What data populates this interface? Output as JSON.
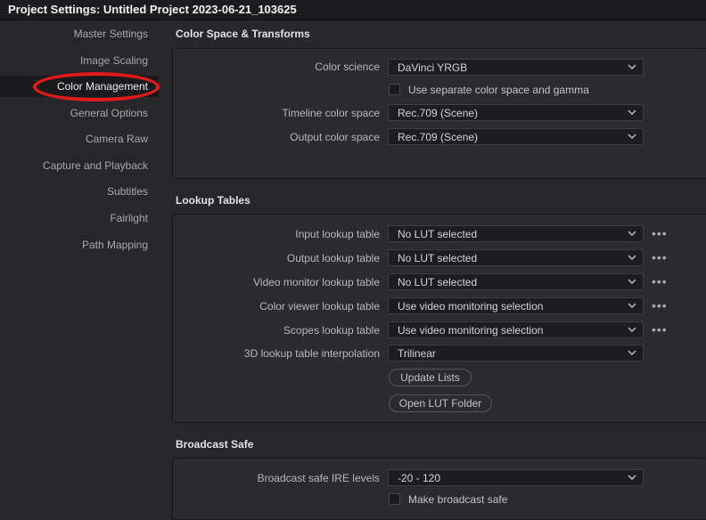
{
  "window": {
    "title": "Project Settings:  Untitled Project 2023-06-21_103625"
  },
  "sidebar": {
    "items": [
      {
        "label": "Master Settings"
      },
      {
        "label": "Image Scaling"
      },
      {
        "label": "Color Management",
        "active": true
      },
      {
        "label": "General Options"
      },
      {
        "label": "Camera Raw"
      },
      {
        "label": "Capture and Playback"
      },
      {
        "label": "Subtitles"
      },
      {
        "label": "Fairlight"
      },
      {
        "label": "Path Mapping"
      }
    ],
    "annotation_color": "#e21a1a"
  },
  "color_space": {
    "title": "Color Space & Transforms",
    "color_science": {
      "label": "Color science",
      "value": "DaVinci YRGB"
    },
    "separate_checkbox": {
      "label": "Use separate color space and gamma",
      "checked": false
    },
    "timeline_color_space": {
      "label": "Timeline color space",
      "value": "Rec.709 (Scene)"
    },
    "output_color_space": {
      "label": "Output color space",
      "value": "Rec.709 (Scene)"
    }
  },
  "lookup_tables": {
    "title": "Lookup Tables",
    "input": {
      "label": "Input lookup table",
      "value": "No LUT selected"
    },
    "output": {
      "label": "Output lookup table",
      "value": "No LUT selected"
    },
    "video_monitor": {
      "label": "Video monitor lookup table",
      "value": "No LUT selected"
    },
    "color_viewer": {
      "label": "Color viewer lookup table",
      "value": "Use video monitoring selection"
    },
    "scopes": {
      "label": "Scopes lookup table",
      "value": "Use video monitoring selection"
    },
    "interpolation": {
      "label": "3D lookup table interpolation",
      "value": "Trilinear"
    },
    "update_button": "Update Lists",
    "open_folder_button": "Open LUT Folder",
    "more_icon": "more-horizontal-icon"
  },
  "broadcast_safe": {
    "title": "Broadcast Safe",
    "ire_levels": {
      "label": "Broadcast safe IRE levels",
      "value": "-20 - 120"
    },
    "make_safe_checkbox": {
      "label": "Make broadcast safe",
      "checked": false
    }
  }
}
